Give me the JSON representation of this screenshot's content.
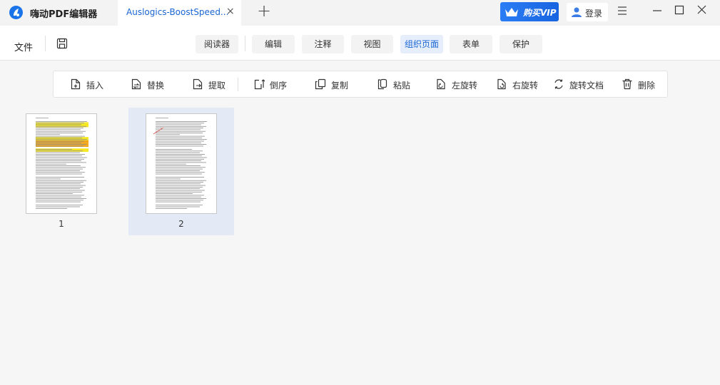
{
  "app": {
    "title": "嗨动PDF编辑器"
  },
  "tab": {
    "label": "Auslogics-BoostSpeed...",
    "close": "×"
  },
  "new_tab": "+",
  "vip": {
    "label": "购买VIP"
  },
  "login": {
    "label": "登录"
  },
  "menubar": {
    "file": "文件",
    "tabs": [
      {
        "label": "阅读器",
        "active": false
      },
      {
        "label": "编辑",
        "active": false
      },
      {
        "label": "注释",
        "active": false
      },
      {
        "label": "视图",
        "active": false
      },
      {
        "label": "组织页面",
        "active": true
      },
      {
        "label": "表单",
        "active": false
      },
      {
        "label": "保护",
        "active": false
      }
    ]
  },
  "toolbar": {
    "items": [
      {
        "label": "插入",
        "icon": "insert-icon"
      },
      {
        "label": "替换",
        "icon": "replace-icon"
      },
      {
        "label": "提取",
        "icon": "extract-icon"
      },
      {
        "label": "倒序",
        "icon": "reverse-icon"
      },
      {
        "label": "复制",
        "icon": "copy-icon"
      },
      {
        "label": "粘贴",
        "icon": "paste-icon"
      },
      {
        "label": "左旋转",
        "icon": "rotate-left-icon"
      },
      {
        "label": "右旋转",
        "icon": "rotate-right-icon"
      },
      {
        "label": "旋转文档",
        "icon": "rotate-document-icon"
      },
      {
        "label": "删除",
        "icon": "delete-icon"
      }
    ]
  },
  "pages": [
    {
      "number": "1",
      "selected": false
    },
    {
      "number": "2",
      "selected": true
    }
  ],
  "colors": {
    "accent": "#1a66d2",
    "vip": "#1f6fe8",
    "selected_page": "#e3e9f5",
    "highlight_yellow": "#f5e71c",
    "highlight_orange": "#f2a516"
  }
}
